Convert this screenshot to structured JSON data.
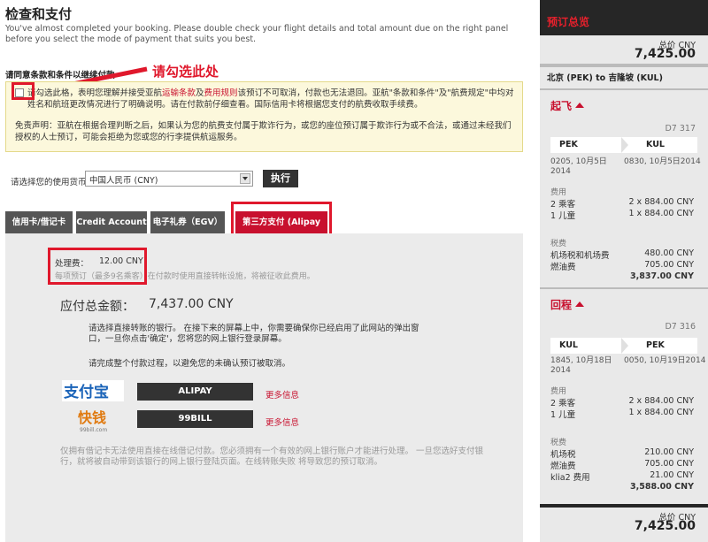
{
  "page": {
    "title": "检查和支付",
    "intro": "You've almost completed your booking. Please double check your flight details and total amount due on the right panel before you select the mode of payment that suits you best."
  },
  "terms": {
    "heading": "请同意条款和条件以继续付款",
    "annotation": "请勾选此处",
    "p1_a": "请勾选此格，表明您理解并接受亚航",
    "link_transport": "运输条款",
    "p1_and": "及",
    "link_fee": "费用规则",
    "p1_b": "该预订不可取消，付款也无法退回。亚航\"条款和条件\"及\"航费规定\"中均对姓名和航班更改情况进行了明确说明。请在付款前仔细查看。国际信用卡将根据您支付的航费收取手续费。",
    "p2": "免责声明：亚航在根据合理判断之后，如果认为您的航费支付属于欺诈行为，或您的座位预订属于欺诈行为或不合法，或通过未经我们授权的人士预订，可能会拒绝为您或您的行李提供航运服务。"
  },
  "currency": {
    "label": "请选择您的使用货币",
    "selected": "中国人民币 (CNY)",
    "run_button": "执行"
  },
  "tabs": [
    {
      "label": "信用卡/借记卡"
    },
    {
      "label": "Credit Account"
    },
    {
      "label": "电子礼券（EGV）"
    },
    {
      "label": "第三方支付 (Alipay ...)"
    }
  ],
  "payment": {
    "fee_label": "处理费：",
    "fee_value": "12.00 CNY",
    "fee_note": "每项预订（最多9名乘客）在付款时使用直接转帐设施，将被征收此费用。",
    "total_label": "应付总金额：",
    "total_value": "7,437.00  CNY",
    "instr1": "请选择直接转账的银行。 在接下来的屏幕上中，你需要确保你已经启用了此网站的弹出窗口，一旦你点击'确定'，您将您的网上银行登录屏幕。",
    "instr2": "请完成整个付款过程，以避免您的未确认预订被取消。",
    "alipay_logo_text": "支付宝",
    "alipay_button": "ALIPAY",
    "kuaiqian_logo_text": "快钱",
    "kuaiqian_sub": "99bill.com",
    "bill_button": "99BILL",
    "more_info": "更多信息",
    "bottom_note": "仅拥有借记卡无法使用直接在线借记付款。您必须拥有一个有效的网上银行账户才能进行处理。 一旦您选好支付银行，就将被自动带到该银行的网上银行登陆页面。在线转账失败 将导致您的预订取消。"
  },
  "summary": {
    "title": "预订总览",
    "total_label": "总价",
    "currency": "CNY",
    "total_value": "7,425.00",
    "route": "北京 (PEK) to 吉隆坡 (KUL)",
    "outbound": {
      "section": "起飞",
      "flight_no": "D7 317",
      "from": "PEK",
      "to": "KUL",
      "depart_time": "0205, 10月5日",
      "depart_year": "2014",
      "arrive_time": "0830, 10月5日2014",
      "fare_label": "费用",
      "fare_rows": [
        {
          "l": "2 乘客",
          "r": "2 x 884.00 CNY"
        },
        {
          "l": "1 儿童",
          "r": "1 x 884.00 CNY"
        }
      ],
      "tax_label": "税费",
      "tax_rows": [
        {
          "l": "机场税和机场费",
          "r": "480.00 CNY"
        },
        {
          "l": "燃油费",
          "r": "705.00 CNY"
        }
      ],
      "subtotal": "3,837.00 CNY"
    },
    "return": {
      "section": "回程",
      "flight_no": "D7 316",
      "from": "KUL",
      "to": "PEK",
      "depart_time": "1845, 10月18日",
      "depart_year": "2014",
      "arrive_time": "0050, 10月19日2014",
      "fare_label": "费用",
      "fare_rows": [
        {
          "l": "2 乘客",
          "r": "2 x 884.00 CNY"
        },
        {
          "l": "1 儿童",
          "r": "1 x 884.00 CNY"
        }
      ],
      "tax_label": "税费",
      "tax_rows": [
        {
          "l": "机场税",
          "r": "210.00 CNY"
        },
        {
          "l": "燃油费",
          "r": "705.00 CNY"
        },
        {
          "l": "klia2 费用",
          "r": "21.00 CNY"
        }
      ],
      "subtotal": "3,588.00 CNY"
    }
  },
  "colors": {
    "brand_red": "#c8102e",
    "annotation_red": "#e0182c",
    "dark": "#262626"
  }
}
